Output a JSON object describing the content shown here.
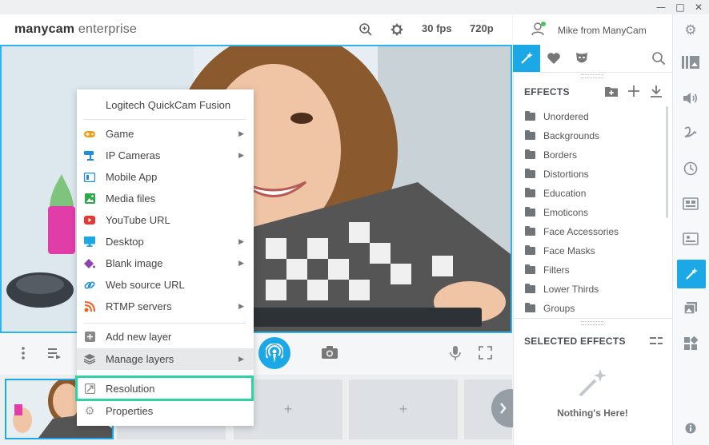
{
  "window": {
    "minimize": "—",
    "maximize": "□",
    "close": "✕"
  },
  "header": {
    "logo_bold": "manycam",
    "logo_rest": " enterprise",
    "fps": "30 fps",
    "resolution": "720p",
    "user": "Mike from ManyCam"
  },
  "effects": {
    "title": "EFFECTS",
    "folders": [
      "Unordered",
      "Backgrounds",
      "Borders",
      "Distortions",
      "Education",
      "Emoticons",
      "Face Accessories",
      "Face Masks",
      "Filters",
      "Lower Thirds",
      "Groups"
    ],
    "selected_title": "SELECTED EFFECTS",
    "empty_text": "Nothing's Here!"
  },
  "menu": {
    "device": "Logitech QuickCam Fusion",
    "items": [
      {
        "label": "Game",
        "icon": "gamepad-icon",
        "color": "#f0a020",
        "submenu": true
      },
      {
        "label": "IP Cameras",
        "icon": "ip-camera-icon",
        "color": "#1e8fd6",
        "submenu": true
      },
      {
        "label": "Mobile App",
        "icon": "mobile-app-icon",
        "color": "#1e8fd6",
        "submenu": false
      },
      {
        "label": "Media files",
        "icon": "media-files-icon",
        "color": "#2ea84a",
        "submenu": false
      },
      {
        "label": "YouTube URL",
        "icon": "youtube-icon",
        "color": "#e53935",
        "submenu": false
      },
      {
        "label": "Desktop",
        "icon": "desktop-icon",
        "color": "#1ca8e6",
        "submenu": true
      },
      {
        "label": "Blank image",
        "icon": "paint-bucket-icon",
        "color": "#8e44ad",
        "submenu": true
      },
      {
        "label": "Web source URL",
        "icon": "link-icon",
        "color": "#1e8fd6",
        "submenu": false
      },
      {
        "label": "RTMP servers",
        "icon": "rtmp-icon",
        "color": "#f06022",
        "submenu": true
      }
    ],
    "add_layer": "Add new layer",
    "manage_layers": "Manage layers",
    "resolution": "Resolution",
    "properties": "Properties"
  },
  "thumbs": {
    "plus": "+"
  },
  "colors": {
    "accent": "#1ca8e6",
    "highlight": "#2ed3a3"
  }
}
